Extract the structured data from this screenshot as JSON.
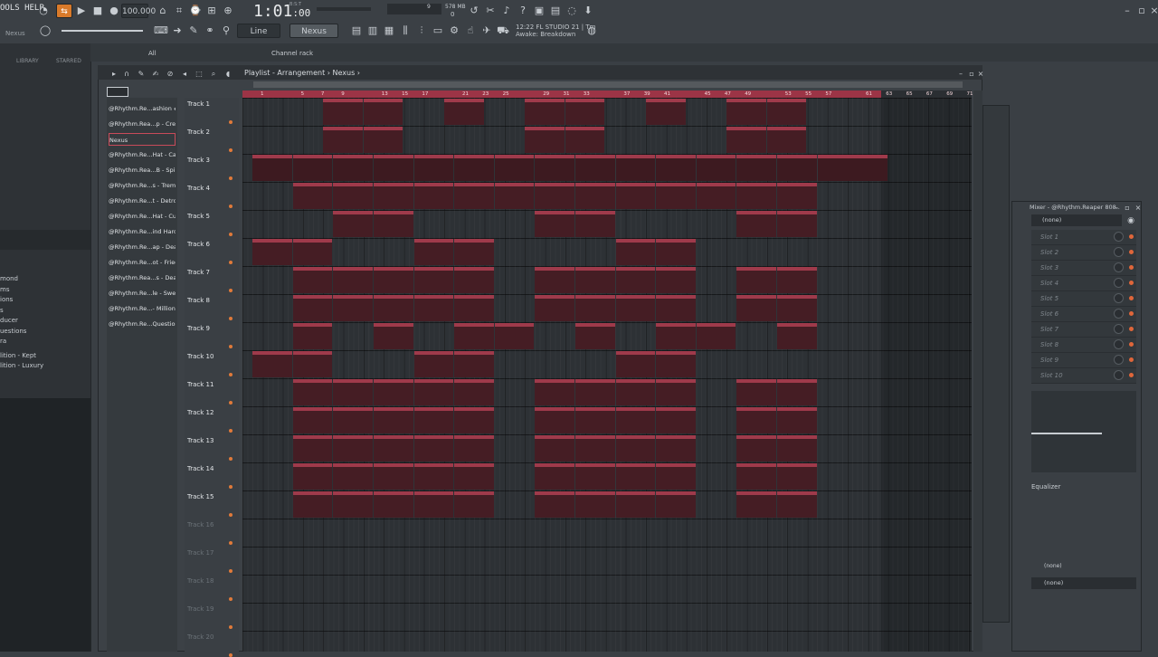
{
  "toolbar": {
    "menu_label": "OOLS HELP",
    "hint_label": "Nexus",
    "tempo": "100.000",
    "time_main": "1:01",
    "time_sub": ":00",
    "time_unit": "B:S:T",
    "cpu_label": "578 MB",
    "cpu_value": "9",
    "voices": "0",
    "snap_label": "Line",
    "pattern_label": "Nexus",
    "song_time": "12:22",
    "app_name": "FL STUDIO 21 | Tm",
    "song_name": "Awake: Breakdown"
  },
  "browser": {
    "tabs": [
      "LIBRARY",
      "STARRED"
    ],
    "items": [
      "mond",
      "ms",
      "ions",
      "s",
      "ducer",
      "uestions",
      "ra",
      "lition - Kept",
      "lition - Luxury"
    ]
  },
  "tabs": {
    "all": "All",
    "channel_rack": "Channel rack"
  },
  "playlist": {
    "title": "Playlist - Arrangement",
    "pattern": "Nexus",
    "clip_list": [
      "@Rhythm.Re...ashion #2",
      "@Rhythm.Rea...p - Credit",
      "Nexus",
      "@Rhythm.Re...Hat - Cash",
      "@Rhythm.Rea...B - Spinz",
      "@Rhythm.Re...s - Tremor",
      "@Rhythm.Re...t - Detroit",
      "@Rhythm.Re...Hat - Cut",
      "@Rhythm.Re...ind Harder",
      "@Rhythm.Re...ap - Dead",
      "@Rhythm.Re...ot - Fried",
      "@Rhythm.Rea...s - Death",
      "@Rhythm.Re...le - Sweet",
      "@Rhythm.Re...- Millions",
      "@Rhythm.Re...Questions"
    ],
    "selected_clip_index": 2,
    "ruler_numbers": [
      "1",
      "5",
      "7",
      "9",
      "13",
      "15",
      "17",
      "21",
      "23",
      "25",
      "29",
      "31",
      "33",
      "37",
      "39",
      "41",
      "45",
      "47",
      "49",
      "53",
      "55",
      "57",
      "61",
      "63",
      "65",
      "67",
      "69",
      "71"
    ],
    "tracks": [
      "Track 1",
      "Track 2",
      "Track 3",
      "Track 4",
      "Track 5",
      "Track 6",
      "Track 7",
      "Track 8",
      "Track 9",
      "Track 10",
      "Track 11",
      "Track 12",
      "Track 13",
      "Track 14",
      "Track 15",
      "Track 16",
      "Track 17",
      "Track 18",
      "Track 19",
      "Track 20"
    ],
    "clips": [
      {
        "track": 0,
        "bar": 9,
        "len": 4,
        "label": "@Rhythm...on #2"
      },
      {
        "track": 0,
        "bar": 13,
        "len": 4,
        "label": "@Rhythm...on #2"
      },
      {
        "track": 0,
        "bar": 21,
        "len": 4,
        "label": "@Rhythm...n #2"
      },
      {
        "track": 0,
        "bar": 29,
        "len": 4,
        "label": "@Rhythm...on #2"
      },
      {
        "track": 0,
        "bar": 33,
        "len": 4,
        "label": "@Rhythm...on #2"
      },
      {
        "track": 0,
        "bar": 41,
        "len": 4,
        "label": "@Rhythm...n #2"
      },
      {
        "track": 0,
        "bar": 49,
        "len": 4,
        "label": "@Rhythm...on #2"
      },
      {
        "track": 0,
        "bar": 53,
        "len": 4,
        "label": "@Rhythm...on #2"
      },
      {
        "track": 1,
        "bar": 9,
        "len": 4,
        "label": "@Rhythm...edit"
      },
      {
        "track": 1,
        "bar": 13,
        "len": 4,
        "label": "@Rhythm...edit"
      },
      {
        "track": 1,
        "bar": 29,
        "len": 4,
        "label": "@Rhythm...edit"
      },
      {
        "track": 1,
        "bar": 33,
        "len": 4,
        "label": "@Rhythm...edit"
      },
      {
        "track": 1,
        "bar": 49,
        "len": 4,
        "label": "@Rhythm...edit"
      },
      {
        "track": 1,
        "bar": 53,
        "len": 4,
        "label": "@Rhythm...edit"
      },
      {
        "track": 2,
        "bar": 2,
        "len": 4,
        "label": "Nexus",
        "nexus": true
      },
      {
        "track": 2,
        "bar": 6,
        "len": 4,
        "label": "Nexus",
        "nexus": true
      },
      {
        "track": 2,
        "bar": 10,
        "len": 4,
        "label": "Nexus",
        "nexus": true
      },
      {
        "track": 2,
        "bar": 14,
        "len": 4,
        "label": "Nexus",
        "nexus": true
      },
      {
        "track": 2,
        "bar": 18,
        "len": 4,
        "label": "Nexus",
        "nexus": true
      },
      {
        "track": 2,
        "bar": 22,
        "len": 4,
        "label": "Nexus",
        "nexus": true
      },
      {
        "track": 2,
        "bar": 26,
        "len": 4,
        "label": "Nexus",
        "nexus": true
      },
      {
        "track": 2,
        "bar": 30,
        "len": 4,
        "label": "Nexus",
        "nexus": true
      },
      {
        "track": 2,
        "bar": 34,
        "len": 4,
        "label": "Nexus",
        "nexus": true
      },
      {
        "track": 2,
        "bar": 38,
        "len": 4,
        "label": "Nexus",
        "nexus": true
      },
      {
        "track": 2,
        "bar": 42,
        "len": 4,
        "label": "Nexus",
        "nexus": true
      },
      {
        "track": 2,
        "bar": 46,
        "len": 4,
        "label": "Nexus",
        "nexus": true
      },
      {
        "track": 2,
        "bar": 50,
        "len": 4,
        "label": "Nexus",
        "nexus": true
      },
      {
        "track": 2,
        "bar": 54,
        "len": 4,
        "label": "Nexus",
        "nexus": true
      },
      {
        "track": 2,
        "bar": 58,
        "len": 7,
        "label": "Nexus",
        "nexus": true
      },
      {
        "track": 3,
        "bar": 6,
        "len": 4,
        "label": "@Rhyt...ash"
      },
      {
        "track": 3,
        "bar": 10,
        "len": 4,
        "label": "@Rhythm...Cash"
      },
      {
        "track": 3,
        "bar": 14,
        "len": 4,
        "label": "@Rhythm...Cash"
      },
      {
        "track": 3,
        "bar": 18,
        "len": 4,
        "label": "@Rhythm...Cash"
      },
      {
        "track": 3,
        "bar": 22,
        "len": 4,
        "label": "@Rhythm...Cash"
      },
      {
        "track": 3,
        "bar": 26,
        "len": 4,
        "label": "@Rhy...sh"
      },
      {
        "track": 3,
        "bar": 30,
        "len": 4,
        "label": "@Rhythm...Cash"
      },
      {
        "track": 3,
        "bar": 34,
        "len": 4,
        "label": "@Rhythm...Cash"
      },
      {
        "track": 3,
        "bar": 38,
        "len": 4,
        "label": "@Rhythm...Cash"
      },
      {
        "track": 3,
        "bar": 42,
        "len": 4,
        "label": "@Rhythm...Cash"
      },
      {
        "track": 3,
        "bar": 46,
        "len": 4,
        "label": "@Rhy...sh"
      },
      {
        "track": 3,
        "bar": 50,
        "len": 4,
        "label": "@Rhythm...Cash"
      },
      {
        "track": 3,
        "bar": 54,
        "len": 4,
        "label": "@Rhythm...Cash"
      },
      {
        "track": 4,
        "bar": 10,
        "len": 4,
        "label": "@Rhythm...inz"
      },
      {
        "track": 4,
        "bar": 14,
        "len": 4,
        "label": "@Rhythm...inz"
      },
      {
        "track": 4,
        "bar": 30,
        "len": 4,
        "label": "@Rhythm...inz"
      },
      {
        "track": 4,
        "bar": 34,
        "len": 4,
        "label": "@Rhythm...inz"
      },
      {
        "track": 4,
        "bar": 50,
        "len": 4,
        "label": "@Rhythm...inz"
      },
      {
        "track": 4,
        "bar": 54,
        "len": 4,
        "label": "@Rhythm...inz"
      },
      {
        "track": 5,
        "bar": 2,
        "len": 4,
        "label": "@Rhythm...emor"
      },
      {
        "track": 5,
        "bar": 6,
        "len": 4,
        "label": "@Rhyth...mor"
      },
      {
        "track": 5,
        "bar": 18,
        "len": 4,
        "label": "@Rhythm...emor"
      },
      {
        "track": 5,
        "bar": 22,
        "len": 4,
        "label": "@Rhythm...emor"
      },
      {
        "track": 5,
        "bar": 38,
        "len": 4,
        "label": "@Rhythm...emor"
      },
      {
        "track": 5,
        "bar": 42,
        "len": 4,
        "label": "@Rhythm...emor"
      },
      {
        "track": 6,
        "bar": 6,
        "len": 4,
        "label": "@Rhy...oit"
      },
      {
        "track": 6,
        "bar": 10,
        "len": 4,
        "label": "@Rhy...oit"
      },
      {
        "track": 6,
        "bar": 14,
        "len": 4,
        "label": "@Rhy...oit"
      },
      {
        "track": 6,
        "bar": 18,
        "len": 4,
        "label": "@Rhy...oit"
      },
      {
        "track": 6,
        "bar": 22,
        "len": 4,
        "label": "@Rhy...oit"
      },
      {
        "track": 6,
        "bar": 30,
        "len": 4,
        "label": "@Rhy...oit"
      },
      {
        "track": 6,
        "bar": 34,
        "len": 4,
        "label": "@Rhy...oit"
      },
      {
        "track": 6,
        "bar": 38,
        "len": 4,
        "label": "@Rhy...oit"
      },
      {
        "track": 6,
        "bar": 42,
        "len": 4,
        "label": "@Rhy...oit"
      },
      {
        "track": 6,
        "bar": 50,
        "len": 4,
        "label": "@Rhy...oit"
      },
      {
        "track": 6,
        "bar": 54,
        "len": 4,
        "label": "@Rhy...oit"
      },
      {
        "track": 7,
        "bar": 6,
        "len": 4,
        "label": "@Rhyt...Cut"
      },
      {
        "track": 7,
        "bar": 10,
        "len": 4,
        "label": "@Rhythm...- Cut"
      },
      {
        "track": 7,
        "bar": 14,
        "len": 4,
        "label": "@Rhythm...- Cut"
      },
      {
        "track": 7,
        "bar": 18,
        "len": 4,
        "label": "@Rhythm...- Cut"
      },
      {
        "track": 7,
        "bar": 22,
        "len": 4,
        "label": "@Rhythm...- Cut"
      },
      {
        "track": 7,
        "bar": 30,
        "len": 4,
        "label": "@Rhythm...- Cut"
      },
      {
        "track": 7,
        "bar": 34,
        "len": 4,
        "label": "@Rhythm...- Cut"
      },
      {
        "track": 7,
        "bar": 38,
        "len": 4,
        "label": "@Rhythm...- Cut"
      },
      {
        "track": 7,
        "bar": 42,
        "len": 4,
        "label": "@Rhythm...- Cut"
      },
      {
        "track": 7,
        "bar": 50,
        "len": 4,
        "label": "@Rhythm...- Cut"
      },
      {
        "track": 7,
        "bar": 54,
        "len": 4,
        "label": "@Rhythm...- Cut"
      },
      {
        "track": 8,
        "bar": 6,
        "len": 4,
        "label": "@Rhyt...rder"
      },
      {
        "track": 8,
        "bar": 14,
        "len": 4,
        "label": "@Rhythm...arder"
      },
      {
        "track": 8,
        "bar": 22,
        "len": 4,
        "label": "@Rhythm...arder"
      },
      {
        "track": 8,
        "bar": 26,
        "len": 4,
        "label": "@Rhy...er"
      },
      {
        "track": 8,
        "bar": 34,
        "len": 4,
        "label": "@Rhythm...arder"
      },
      {
        "track": 8,
        "bar": 42,
        "len": 4,
        "label": "@Rhythm...arder"
      },
      {
        "track": 8,
        "bar": 46,
        "len": 4,
        "label": "@Rhy...er"
      },
      {
        "track": 8,
        "bar": 54,
        "len": 4,
        "label": "@Rhythm...arder"
      },
      {
        "track": 9,
        "bar": 2,
        "len": 4,
        "label": "@Rhythm...ead"
      },
      {
        "track": 9,
        "bar": 6,
        "len": 4,
        "label": "@Rhyth...ad"
      },
      {
        "track": 9,
        "bar": 18,
        "len": 4,
        "label": "@Rhythm...ead"
      },
      {
        "track": 9,
        "bar": 22,
        "len": 4,
        "label": "@Rhythm...ead"
      },
      {
        "track": 9,
        "bar": 38,
        "len": 4,
        "label": "@Rhythm...ead"
      },
      {
        "track": 9,
        "bar": 42,
        "len": 4,
        "label": "@Rhythm...ead"
      },
      {
        "track": 10,
        "bar": 6,
        "len": 4,
        "label": "@Rhyth...ied"
      },
      {
        "track": 10,
        "bar": 10,
        "len": 4,
        "label": "@Rhythm...ried"
      },
      {
        "track": 10,
        "bar": 14,
        "len": 4,
        "label": "@Rhythm...ried"
      },
      {
        "track": 10,
        "bar": 18,
        "len": 4,
        "label": "@Rhythm...ried"
      },
      {
        "track": 10,
        "bar": 22,
        "len": 4,
        "label": "@Rhythm...ried"
      },
      {
        "track": 10,
        "bar": 30,
        "len": 4,
        "label": "@Rhythm...ried"
      },
      {
        "track": 10,
        "bar": 34,
        "len": 4,
        "label": "@Rhythm...ried"
      },
      {
        "track": 10,
        "bar": 38,
        "len": 4,
        "label": "@Rhythm...ried"
      },
      {
        "track": 10,
        "bar": 42,
        "len": 4,
        "label": "@Rhythm...ried"
      },
      {
        "track": 10,
        "bar": 50,
        "len": 4,
        "label": "@Rhythm...ried"
      },
      {
        "track": 10,
        "bar": 54,
        "len": 4,
        "label": "@Rhythm...ried"
      },
      {
        "track": 11,
        "bar": 6,
        "len": 4,
        "label": "@Rhyth...th"
      },
      {
        "track": 11,
        "bar": 10,
        "len": 4,
        "label": "@Rhythm...ath"
      },
      {
        "track": 11,
        "bar": 14,
        "len": 4,
        "label": "@Rhythm...ath"
      },
      {
        "track": 11,
        "bar": 18,
        "len": 4,
        "label": "@Rhythm...ath"
      },
      {
        "track": 11,
        "bar": 22,
        "len": 4,
        "label": "@Rhythm...ath"
      },
      {
        "track": 11,
        "bar": 30,
        "len": 4,
        "label": "@Rhythm...ath"
      },
      {
        "track": 11,
        "bar": 34,
        "len": 4,
        "label": "@Rhythm...ath"
      },
      {
        "track": 11,
        "bar": 38,
        "len": 4,
        "label": "@Rhythm...ath"
      },
      {
        "track": 11,
        "bar": 42,
        "len": 4,
        "label": "@Rhythm...ath"
      },
      {
        "track": 11,
        "bar": 50,
        "len": 4,
        "label": "@Rhythm...ath"
      },
      {
        "track": 11,
        "bar": 54,
        "len": 4,
        "label": "@Rhythm...ath"
      },
      {
        "track": 12,
        "bar": 6,
        "len": 4,
        "label": "@Rhyth...eet"
      },
      {
        "track": 12,
        "bar": 10,
        "len": 4,
        "label": "@Rhythm...weet"
      },
      {
        "track": 12,
        "bar": 14,
        "len": 4,
        "label": "@Rhythm...weet"
      },
      {
        "track": 12,
        "bar": 18,
        "len": 4,
        "label": "@Rhythm...weet"
      },
      {
        "track": 12,
        "bar": 22,
        "len": 4,
        "label": "@Rhythm...weet"
      },
      {
        "track": 12,
        "bar": 30,
        "len": 4,
        "label": "@Rhythm...weet"
      },
      {
        "track": 12,
        "bar": 34,
        "len": 4,
        "label": "@Rhythm...weet"
      },
      {
        "track": 12,
        "bar": 38,
        "len": 4,
        "label": "@Rhythm...weet"
      },
      {
        "track": 12,
        "bar": 42,
        "len": 4,
        "label": "@Rhythm...weet"
      },
      {
        "track": 12,
        "bar": 50,
        "len": 4,
        "label": "@Rhythm...weet"
      },
      {
        "track": 12,
        "bar": 54,
        "len": 4,
        "label": "@Rhythm...weet"
      },
      {
        "track": 13,
        "bar": 6,
        "len": 4,
        "label": "@Rhy...ns"
      },
      {
        "track": 13,
        "bar": 10,
        "len": 4,
        "label": "@Rhy...ns"
      },
      {
        "track": 13,
        "bar": 14,
        "len": 4,
        "label": "@Rhy...ns"
      },
      {
        "track": 13,
        "bar": 18,
        "len": 4,
        "label": "@Rhy...ns"
      },
      {
        "track": 13,
        "bar": 22,
        "len": 4,
        "label": "@Rhy...ns"
      },
      {
        "track": 13,
        "bar": 30,
        "len": 4,
        "label": "@Rhy...ns"
      },
      {
        "track": 13,
        "bar": 34,
        "len": 4,
        "label": "@Rhy...ns"
      },
      {
        "track": 13,
        "bar": 38,
        "len": 4,
        "label": "@Rhy...ns"
      },
      {
        "track": 13,
        "bar": 42,
        "len": 4,
        "label": "@Rhy...ns"
      },
      {
        "track": 13,
        "bar": 50,
        "len": 4,
        "label": "@Rhy...ns"
      },
      {
        "track": 13,
        "bar": 54,
        "len": 4,
        "label": "@Rhy...ns"
      },
      {
        "track": 14,
        "bar": 6,
        "len": 4,
        "label": "@Rhyt...ions"
      },
      {
        "track": 14,
        "bar": 10,
        "len": 4,
        "label": "@Rhythm...tions"
      },
      {
        "track": 14,
        "bar": 14,
        "len": 4,
        "label": "@Rhythm...tions"
      },
      {
        "track": 14,
        "bar": 18,
        "len": 4,
        "label": "@Rhythm...tions"
      },
      {
        "track": 14,
        "bar": 22,
        "len": 4,
        "label": "@Rhythm...tions"
      },
      {
        "track": 14,
        "bar": 30,
        "len": 4,
        "label": "@Rhythm...tions"
      },
      {
        "track": 14,
        "bar": 34,
        "len": 4,
        "label": "@Rhythm...tions"
      },
      {
        "track": 14,
        "bar": 38,
        "len": 4,
        "label": "@Rhythm...tions"
      },
      {
        "track": 14,
        "bar": 42,
        "len": 4,
        "label": "@Rhythm...tions"
      },
      {
        "track": 14,
        "bar": 50,
        "len": 4,
        "label": "@Rhythm...tions"
      },
      {
        "track": 14,
        "bar": 54,
        "len": 4,
        "label": "@Rhythm...tions"
      }
    ]
  },
  "mixer": {
    "title": "Mixer - @Rhythm.Reaper 808..",
    "input": "(none)",
    "slots": [
      "Slot 1",
      "Slot 2",
      "Slot 3",
      "Slot 4",
      "Slot 5",
      "Slot 6",
      "Slot 7",
      "Slot 8",
      "Slot 9",
      "Slot 10"
    ],
    "eq_label": "Equalizer",
    "output_1": "(none)",
    "output_2": "(none)"
  },
  "colors": {
    "accent": "#9f3a4b",
    "clip_body": "#451d24",
    "led": "#e0663a"
  }
}
